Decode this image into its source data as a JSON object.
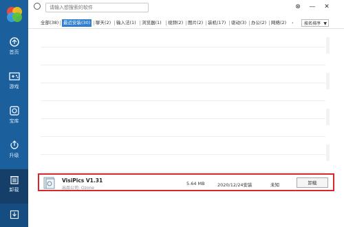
{
  "sidebar": {
    "items": [
      {
        "label": "首页",
        "icon": "monitor-icon"
      },
      {
        "label": "游戏",
        "icon": "gamepad-icon"
      },
      {
        "label": "宝库",
        "icon": "treasure-icon"
      },
      {
        "label": "升级",
        "icon": "upgrade-icon"
      },
      {
        "label": "卸载",
        "icon": "trash-icon"
      }
    ],
    "active_index": 4,
    "bottom_icon": "download-icon",
    "colors": {
      "bg": "#1b5f9c",
      "active": "#153f68"
    }
  },
  "search": {
    "placeholder": "请输入想搜索的软件"
  },
  "window": {
    "settings_icon": "gear-icon",
    "minimize_icon": "minimize-icon",
    "close_icon": "close-icon"
  },
  "tabs": [
    {
      "label": "全部(38)"
    },
    {
      "label": "最近安装(30)"
    },
    {
      "label": "聊天(2)"
    },
    {
      "label": "输入法(1)"
    },
    {
      "label": "浏览器(1)"
    },
    {
      "label": "视频(2)"
    },
    {
      "label": "图片(2)"
    },
    {
      "label": "装机(17)"
    },
    {
      "label": "驱动(3)"
    },
    {
      "label": "办公(2)"
    },
    {
      "label": "网络(2)"
    }
  ],
  "active_tab_index": 1,
  "tabs_more_icon": "chevron-right-icon",
  "sort": {
    "label": "按名排序",
    "icon": "chevron-down-icon"
  },
  "app": {
    "name": "VisiPics V1.31",
    "publisher_label": "出品公司:",
    "publisher": "Ozone",
    "size": "5.64 MB",
    "date": "2020/12/24安装",
    "status": "未知",
    "uninstall_label": "卸载",
    "highlight_color": "#d9262c"
  }
}
